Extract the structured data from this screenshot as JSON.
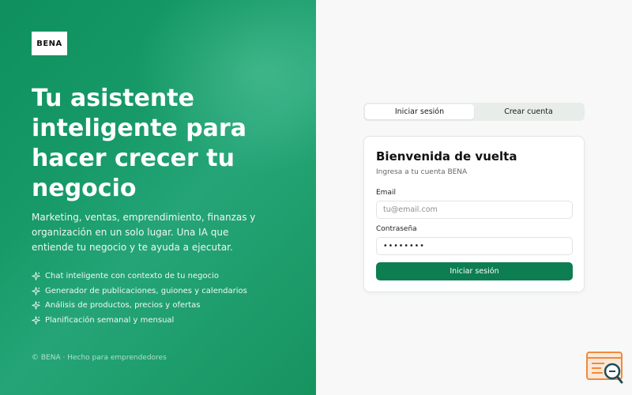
{
  "brand": {
    "logo_text": "BENA"
  },
  "hero": {
    "headline": "Tu asistente inteligente para hacer crecer tu negocio",
    "description": "Marketing, ventas, emprendimiento, finanzas y organización en un solo lugar. Una IA que entiende tu negocio y te ayuda a ejecutar.",
    "features": [
      {
        "icon": "sparkle-icon",
        "label": "Chat inteligente con contexto de tu negocio"
      },
      {
        "icon": "sparkle-icon",
        "label": "Generador de publicaciones, guiones y calendarios"
      },
      {
        "icon": "sparkle-icon",
        "label": "Análisis de productos, precios y ofertas"
      },
      {
        "icon": "sparkle-icon",
        "label": "Planificación semanal y mensual"
      }
    ],
    "footer": "© BENA · Hecho para emprendedores"
  },
  "auth": {
    "tabs": [
      {
        "label": "Iniciar sesión",
        "active": true
      },
      {
        "label": "Crear cuenta",
        "active": false
      }
    ],
    "card": {
      "title": "Bienvenida de vuelta",
      "subtitle": "Ingresa a tu cuenta BENA",
      "email_label": "Email",
      "email_placeholder": "tu@email.com",
      "email_value": "",
      "password_label": "Contraseña",
      "password_value": "••••••••",
      "submit_label": "Iniciar sesión"
    }
  },
  "colors": {
    "brand_green": "#0d7d52",
    "hero_green": "#179a68",
    "widget_orange": "#f08a3c",
    "widget_teal": "#1f4b57"
  },
  "widget": {
    "icon": "search-document-icon"
  }
}
